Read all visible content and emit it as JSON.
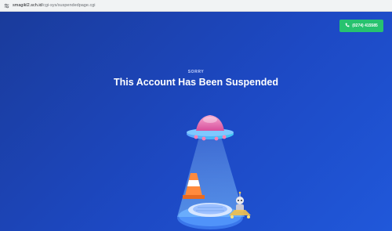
{
  "browser": {
    "url_host": "smagikl2.sch.id",
    "url_path": "/cgi-sys/suspendedpage.cgi",
    "site_icon": "tune-icon"
  },
  "contact": {
    "phone_label": "(0274) 415585",
    "icon": "phone-icon",
    "color": "#27c26f"
  },
  "message": {
    "eyebrow": "SORRY",
    "title": "This Account Has Been Suspended"
  },
  "theme": {
    "background": "#1d49c4"
  },
  "illustration": {
    "icon": "ufo-abduction-illustration"
  }
}
